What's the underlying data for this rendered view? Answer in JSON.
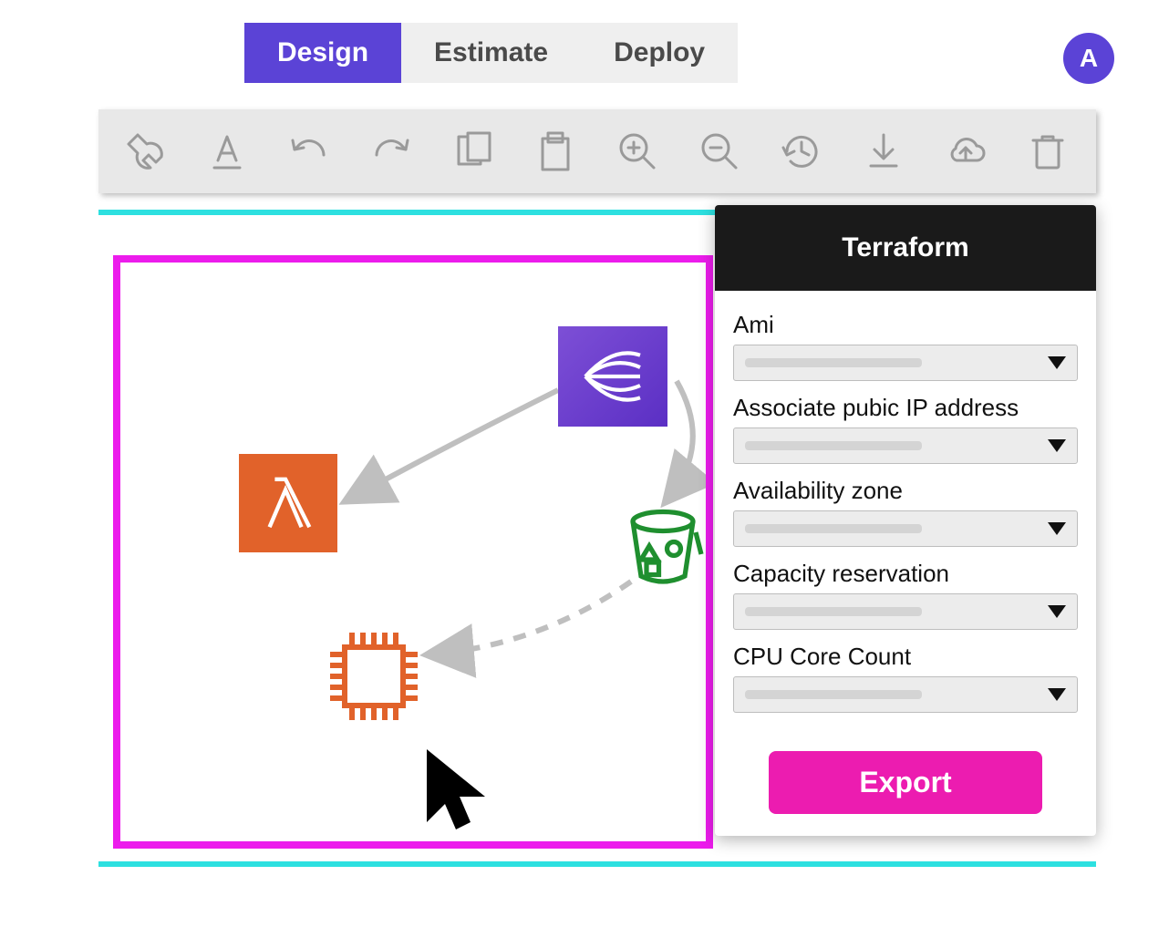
{
  "tabs": {
    "design": "Design",
    "estimate": "Estimate",
    "deploy": "Deploy",
    "active": "design"
  },
  "avatar": {
    "initial": "A"
  },
  "toolbar": {
    "icons": [
      "wrench",
      "text-format",
      "undo",
      "redo",
      "copy",
      "paste",
      "zoom-in",
      "zoom-out",
      "history",
      "download",
      "cloud-upload",
      "trash"
    ]
  },
  "canvas": {
    "nodes": {
      "lambda": "aws-lambda-service",
      "kinesis": "aws-kinesis-service",
      "bucket": "aws-s3-bucket",
      "cpu": "compute-chip-component"
    }
  },
  "panel": {
    "title": "Terraform",
    "fields": [
      {
        "label": "Ami"
      },
      {
        "label": "Associate pubic IP address"
      },
      {
        "label": "Availability zone"
      },
      {
        "label": "Capacity reservation"
      },
      {
        "label": "CPU Core Count"
      }
    ],
    "export_label": "Export"
  },
  "colors": {
    "accent": "#5b43d6",
    "magenta": "#ec1cec",
    "cyan": "#2de0e0",
    "export": "#ec1cb0",
    "lambda": "#e1622a",
    "kinesis": "#5b2fc4",
    "bucket": "#1f8f2f",
    "cpu": "#e1622a"
  }
}
